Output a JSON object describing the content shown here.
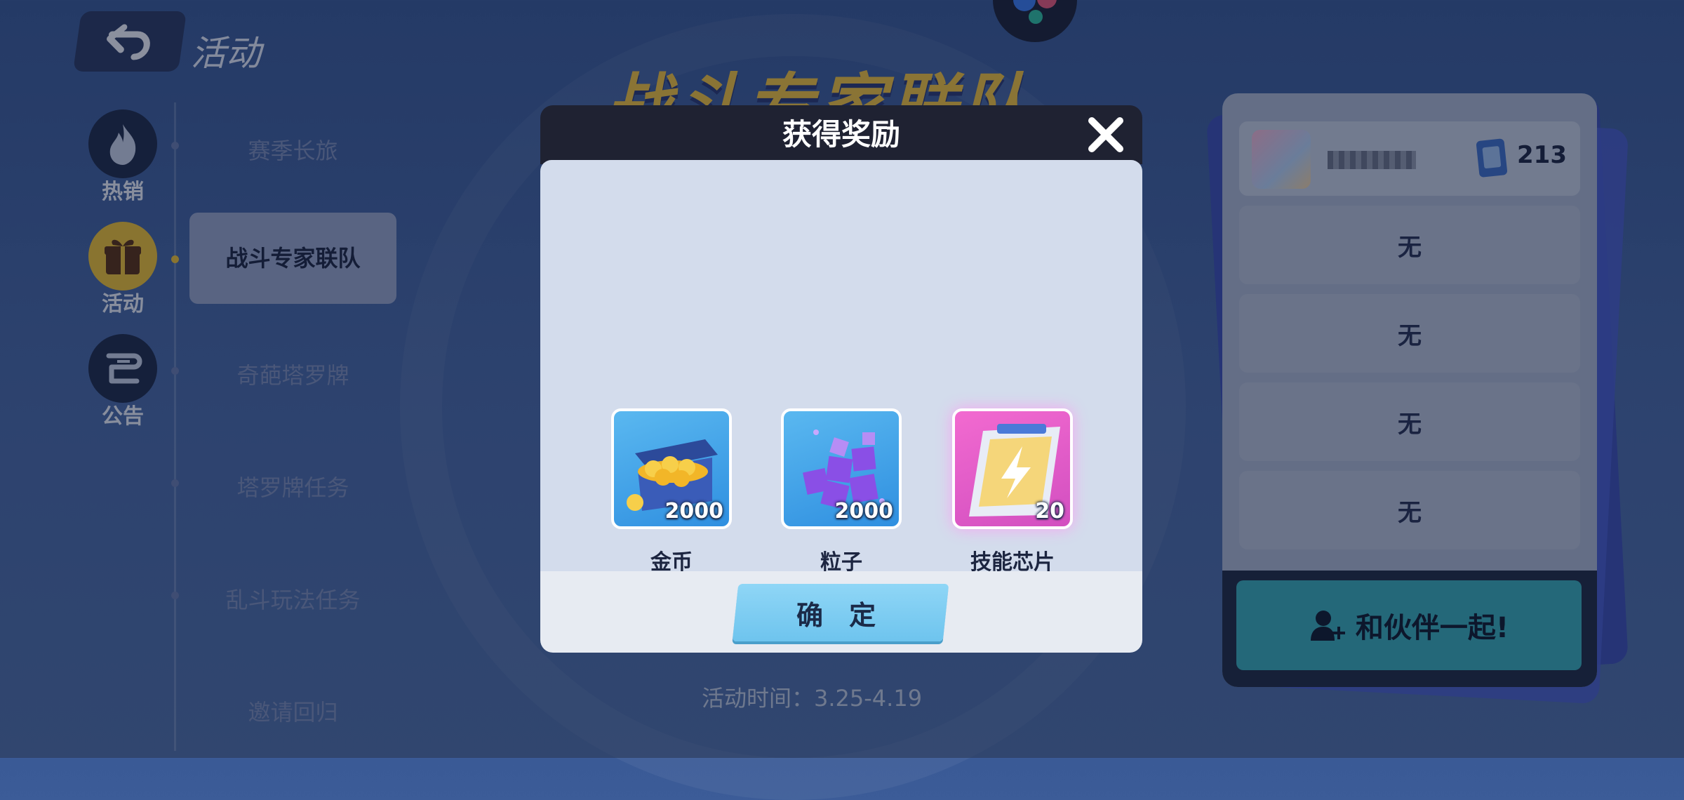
{
  "header": {
    "title": "活动"
  },
  "banner": {
    "title": "战斗专家联队"
  },
  "categories": [
    {
      "label": "热销",
      "icon": "flame-icon"
    },
    {
      "label": "活动",
      "icon": "gift-icon",
      "active": true
    },
    {
      "label": "公告",
      "icon": "scroll-icon"
    }
  ],
  "nav": [
    {
      "label": "赛季长旅"
    },
    {
      "label": "战斗专家联队",
      "active": true
    },
    {
      "label": "奇葩塔罗牌"
    },
    {
      "label": "塔罗牌任务"
    },
    {
      "label": "乱斗玩法任务"
    },
    {
      "label": "邀请回归"
    }
  ],
  "activity_time": "活动时间：3.25-4.19",
  "team_panel": {
    "score": "213",
    "slots": [
      "无",
      "无",
      "无",
      "无"
    ],
    "partner_button": "和伙伴一起!"
  },
  "modal": {
    "title": "获得奖励",
    "confirm": "确 定",
    "rewards": [
      {
        "name": "金币",
        "qty": "2000",
        "icon": "gold-chest-icon"
      },
      {
        "name": "粒子",
        "qty": "2000",
        "icon": "particle-cubes-icon"
      },
      {
        "name": "技能芯片",
        "qty": "20",
        "icon": "skill-chip-icon"
      }
    ]
  },
  "colors": {
    "modal_header": "#1f2232",
    "modal_body": "#d3dcec",
    "confirm": "#7ccdf2",
    "active_gold": "#f0c433",
    "partner_button": "#39aeb8"
  }
}
